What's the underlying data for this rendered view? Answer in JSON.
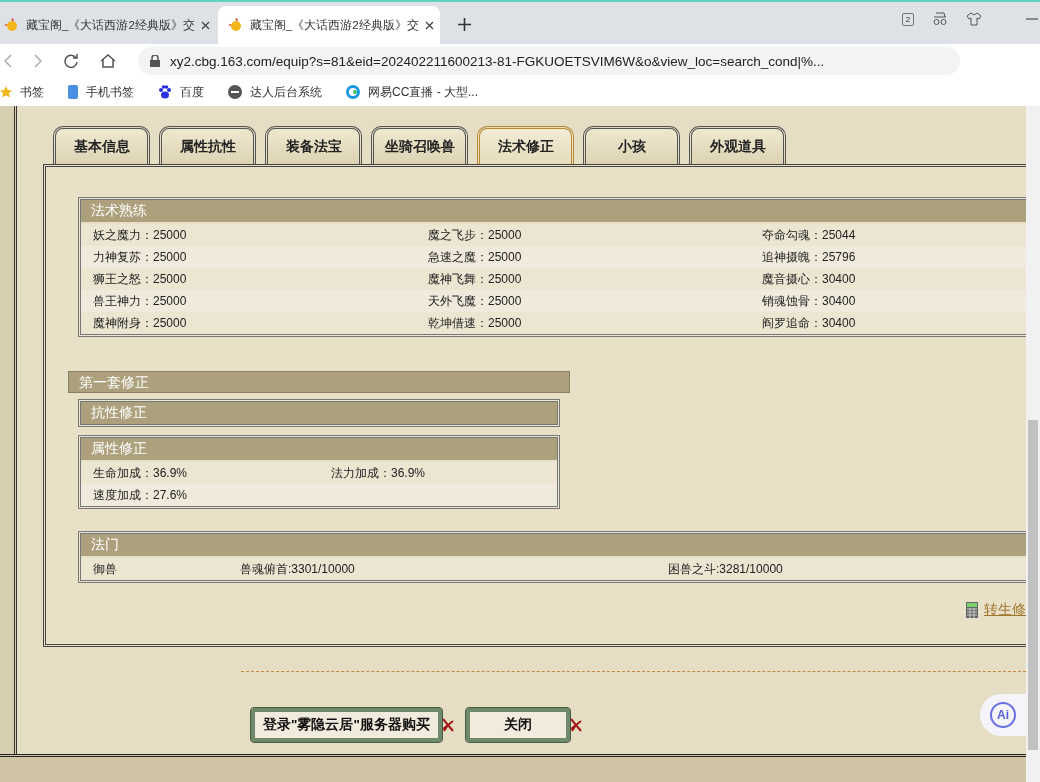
{
  "browser": {
    "tabs": [
      {
        "title": "藏宝阁_《大话西游2经典版》交",
        "selected": false
      },
      {
        "title": "藏宝阁_《大话西游2经典版》交",
        "selected": true
      }
    ],
    "tab_count": "2",
    "address": "xy2.cbg.163.com/equip?s=81&eid=202402211600213-81-FGKUOETSVIM6W&o&view_loc=search_cond|%...",
    "bookmarks": [
      "书签",
      "手机书签",
      "百度",
      "达人后台系统",
      "网易CC直播 - 大型..."
    ]
  },
  "tabs": [
    {
      "label": "基本信息",
      "selected": false
    },
    {
      "label": "属性抗性",
      "selected": false
    },
    {
      "label": "装备法宝",
      "selected": false
    },
    {
      "label": "坐骑召唤兽",
      "selected": false
    },
    {
      "label": "法术修正",
      "selected": true
    },
    {
      "label": "小孩",
      "selected": false
    },
    {
      "label": "外观道具",
      "selected": false
    }
  ],
  "skill_mastery": {
    "title": "法术熟练",
    "rows": [
      [
        "妖之魔力：25000",
        "魔之飞步：25000",
        "夺命勾魂：25044"
      ],
      [
        "力神复苏：25000",
        "急速之魔：25000",
        "追神摄魄：25796"
      ],
      [
        "狮王之怒：25000",
        "魔神飞舞：25000",
        "魔音摄心：30400"
      ],
      [
        "兽王神力：25000",
        "天外飞魔：25000",
        "销魂蚀骨：30400"
      ],
      [
        "魔神附身：25000",
        "乾坤借速：25000",
        "阎罗追命：30400"
      ]
    ]
  },
  "correction_set": {
    "title": "第一套修正",
    "resistance": {
      "title": "抗性修正"
    },
    "attributes": {
      "title": "属性修正",
      "rows": [
        [
          "生命加成：36.9%",
          "法力加成：36.9%"
        ],
        [
          "速度加成：27.6%"
        ]
      ]
    }
  },
  "school": {
    "title": "法门",
    "rows": [
      [
        "御兽",
        "兽魂俯首:3301/10000",
        "困兽之斗:3281/10000"
      ]
    ]
  },
  "rebirth_link": "转生修",
  "buttons": [
    "登录\"雾隐云居\"服务器购买",
    "关闭"
  ],
  "ai_button": "Ai"
}
